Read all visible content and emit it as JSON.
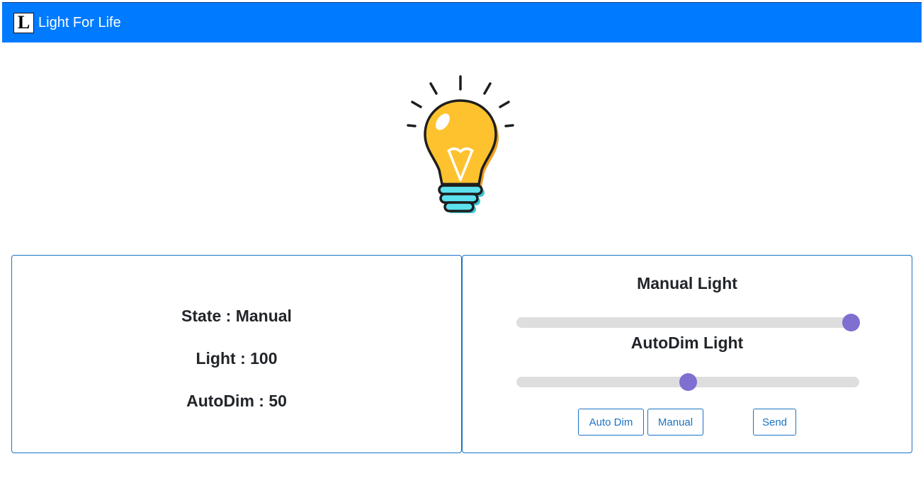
{
  "navbar": {
    "logo_letter": "L",
    "brand": "Light For Life",
    "color": "#007bff"
  },
  "bulb": {
    "icon": "light-bulb-icon",
    "glass_color": "#fdc22e",
    "base_color": "#5ce1ef"
  },
  "status": {
    "state": "State : Manual",
    "light": "Light : 100",
    "autodim": "AutoDim : 50"
  },
  "controls": {
    "manual_title": "Manual Light",
    "manual_value": 100,
    "autodim_title": "AutoDim Light",
    "autodim_value": 50,
    "slider_min": 0,
    "slider_max": 100,
    "thumb_color": "#7e6fd1",
    "buttons": {
      "auto_dim": "Auto Dim",
      "manual": "Manual",
      "send": "Send"
    }
  }
}
